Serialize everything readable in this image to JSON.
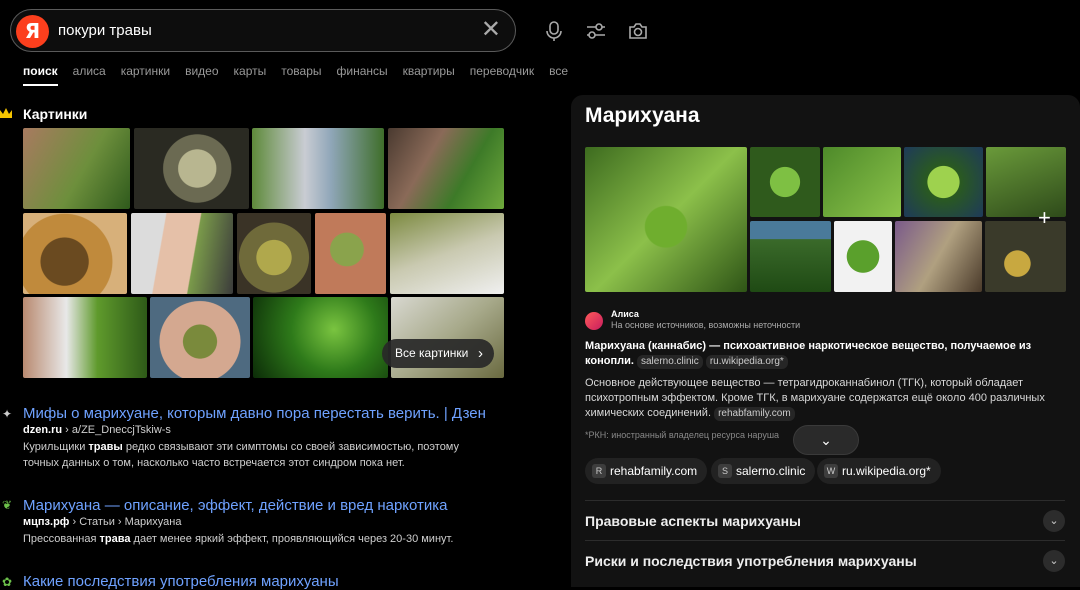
{
  "search": {
    "logo": "Я",
    "query": "покури травы",
    "clear_icon": "close-icon",
    "tools": [
      "microphone-icon",
      "settings-sliders-icon",
      "camera-icon"
    ]
  },
  "tabs": [
    {
      "label": "поиск",
      "active": true
    },
    {
      "label": "алиса"
    },
    {
      "label": "картинки"
    },
    {
      "label": "видео"
    },
    {
      "label": "карты"
    },
    {
      "label": "товары"
    },
    {
      "label": "финансы"
    },
    {
      "label": "квартиры"
    },
    {
      "label": "переводчик"
    },
    {
      "label": "все"
    }
  ],
  "images_section": {
    "title": "Картинки",
    "all_button": "Все картинки",
    "chevron": "›"
  },
  "results": [
    {
      "icon": "✦",
      "title": "Мифы о марихуане, которым давно пора перестать верить. | Дзен",
      "url_domain": "dzen.ru",
      "url_path": " › a/ZE_DneccjTskiw-s",
      "snippet_pre": "Курильщики ",
      "snippet_bold": "травы",
      "snippet_post": " редко связывают эти симптомы со своей зависимостью, поэтому точных данных о том, насколько часто встречается этот синдром пока нет."
    },
    {
      "icon": "❦",
      "title": "Марихуана — описание, эффект, действие и вред наркотика",
      "url_domain": "мцпз.рф",
      "url_path": " › Статьи › Марихуана",
      "snippet_pre": "Прессованная ",
      "snippet_bold": "трава",
      "snippet_post": " дает менее яркий эффект, проявляющийся через 20-30 минут."
    },
    {
      "icon": "✿",
      "title": "Какие последствия употребления марихуаны"
    }
  ],
  "panel": {
    "title": "Марихуана",
    "plus": "+",
    "alisa_name": "Алиса",
    "alisa_sub": "На основе источников, возможны неточности",
    "p1_bold": "Марихуана (каннабис) — психоактивное наркотическое вещество, получаемое из конопли.",
    "p1_chip1": "salerno.clinic",
    "p1_chip2": "ru.wikipedia.org*",
    "p2": "Основное действующее вещество — тетрагидроканнабинол (ТГК), который обладает психотропным эффектом. Кроме ТГК, в марихуане содержатся ещё около 400 различных химических соединений.",
    "p2_chip": "rehabfamily.com",
    "note": "*РКН: иностранный владелец ресурса наруша",
    "expand": "⌄",
    "sources": [
      {
        "label": "rehabfamily.com",
        "icon": "R"
      },
      {
        "label": "salerno.clinic",
        "icon": "S"
      },
      {
        "label": "ru.wikipedia.org*",
        "icon": "W"
      }
    ],
    "accordion": [
      {
        "label": "Правовые аспекты марихуаны"
      },
      {
        "label": "Риски и последствия употребления марихуаны"
      }
    ]
  }
}
